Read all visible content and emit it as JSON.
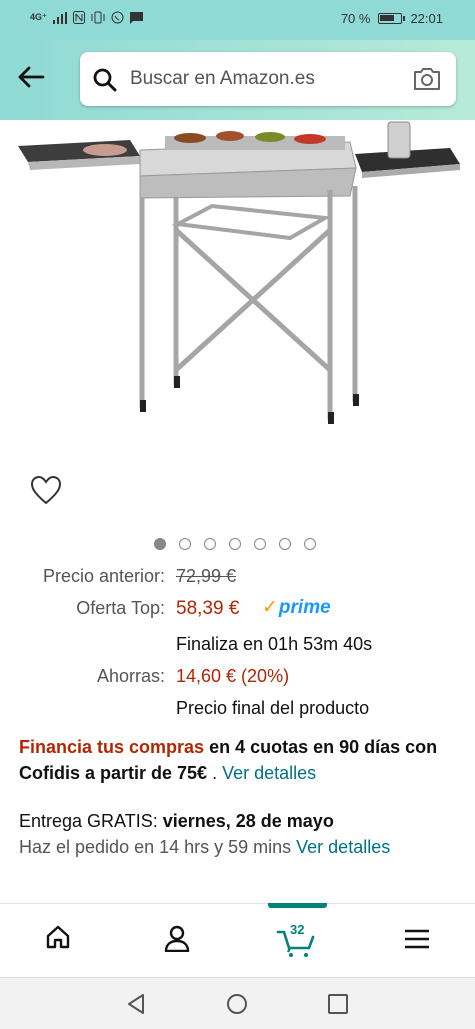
{
  "status_bar": {
    "network": "4G⁺",
    "battery_percent": "70 %",
    "time": "22:01"
  },
  "search": {
    "placeholder": "Buscar en Amazon.es"
  },
  "carousel": {
    "total_images": 7,
    "active_index": 0
  },
  "pricing": {
    "previous_label": "Precio anterior:",
    "previous_price": "72,99 €",
    "offer_label": "Oferta Top:",
    "offer_price": "58,39 €",
    "prime_label": "prime",
    "ends_text": "Finaliza en 01h 53m 40s",
    "savings_label": "Ahorras:",
    "savings_value": "14,60 € (20%)",
    "final_text": "Precio final del producto"
  },
  "financing": {
    "highlight": "Financia tus compras",
    "rest": " en 4 cuotas en 90 días con Cofidis a partir de 75€",
    "dot": " . ",
    "link": "Ver detalles"
  },
  "delivery": {
    "prefix": "Entrega GRATIS: ",
    "date": "viernes, 28 de mayo",
    "order_text": "Haz el pedido en 14 hrs y 59 mins ",
    "link": "Ver detalles"
  },
  "bottom_nav": {
    "cart_count": "32"
  },
  "colors": {
    "header": "#8fdad5",
    "price_red": "#b12704",
    "link": "#007185",
    "accent": "#00827d",
    "prime_blue": "#1a98ff"
  }
}
